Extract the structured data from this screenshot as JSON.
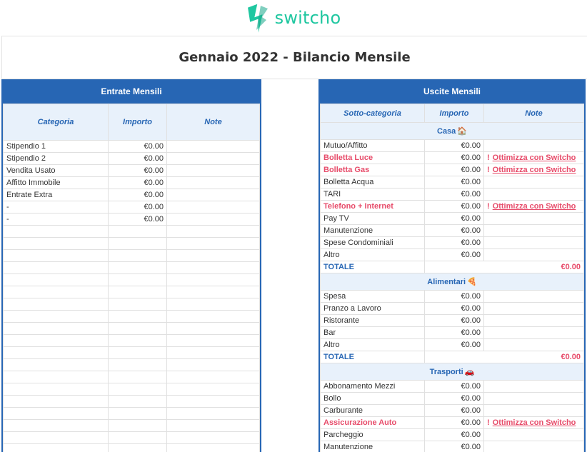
{
  "brand": {
    "name": "switcho",
    "color": "#1fc7a0",
    "accent": "#2766b4",
    "highlight": "#e74c6a"
  },
  "page": {
    "title": "Gennaio 2022 - Bilancio Mensile"
  },
  "income": {
    "header": "Entrate Mensili",
    "columns": [
      "Categoria",
      "Importo",
      "Note"
    ],
    "rows": [
      {
        "label": "Stipendio 1",
        "amount": "€0.00"
      },
      {
        "label": "Stipendio 2",
        "amount": "€0.00"
      },
      {
        "label": "Vendita Usato",
        "amount": "€0.00"
      },
      {
        "label": "Affitto Immobile",
        "amount": "€0.00"
      },
      {
        "label": "Entrate Extra",
        "amount": "€0.00"
      },
      {
        "label": "-",
        "amount": "€0.00"
      },
      {
        "label": "-",
        "amount": "€0.00"
      }
    ],
    "empty_rows": 19
  },
  "expenses": {
    "header": "Uscite Mensili",
    "columns": [
      "Sotto-categoria",
      "Importo",
      "Note"
    ],
    "cta": "Ottimizza con Switcho",
    "total_label": "TOTALE",
    "groups": [
      {
        "name": "Casa",
        "icon": "house-icon",
        "glyph": "🏠",
        "rows": [
          {
            "label": "Mutuo/Affitto",
            "amount": "€0.00",
            "highlight": false
          },
          {
            "label": "Bolletta Luce",
            "amount": "€0.00",
            "highlight": true
          },
          {
            "label": "Bolletta Gas",
            "amount": "€0.00",
            "highlight": true
          },
          {
            "label": "Bolletta Acqua",
            "amount": "€0.00",
            "highlight": false
          },
          {
            "label": "TARI",
            "amount": "€0.00",
            "highlight": false
          },
          {
            "label": "Telefono + Internet",
            "amount": "€0.00",
            "highlight": true
          },
          {
            "label": "Pay TV",
            "amount": "€0.00",
            "highlight": false
          },
          {
            "label": "Manutenzione",
            "amount": "€0.00",
            "highlight": false
          },
          {
            "label": "Spese Condominiali",
            "amount": "€0.00",
            "highlight": false
          },
          {
            "label": "Altro",
            "amount": "€0.00",
            "highlight": false
          }
        ],
        "total": "€0.00"
      },
      {
        "name": "Alimentari",
        "icon": "pizza-icon",
        "glyph": "🍕",
        "rows": [
          {
            "label": "Spesa",
            "amount": "€0.00",
            "highlight": false
          },
          {
            "label": "Pranzo a Lavoro",
            "amount": "€0.00",
            "highlight": false
          },
          {
            "label": "Ristorante",
            "amount": "€0.00",
            "highlight": false
          },
          {
            "label": "Bar",
            "amount": "€0.00",
            "highlight": false
          },
          {
            "label": "Altro",
            "amount": "€0.00",
            "highlight": false
          }
        ],
        "total": "€0.00"
      },
      {
        "name": "Trasporti",
        "icon": "car-icon",
        "glyph": "🚗",
        "rows": [
          {
            "label": "Abbonamento Mezzi",
            "amount": "€0.00",
            "highlight": false
          },
          {
            "label": "Bollo",
            "amount": "€0.00",
            "highlight": false
          },
          {
            "label": "Carburante",
            "amount": "€0.00",
            "highlight": false
          },
          {
            "label": "Assicurazione Auto",
            "amount": "€0.00",
            "highlight": true
          },
          {
            "label": "Parcheggio",
            "amount": "€0.00",
            "highlight": false
          },
          {
            "label": "Manutenzione",
            "amount": "€0.00",
            "highlight": false
          }
        ]
      }
    ]
  }
}
